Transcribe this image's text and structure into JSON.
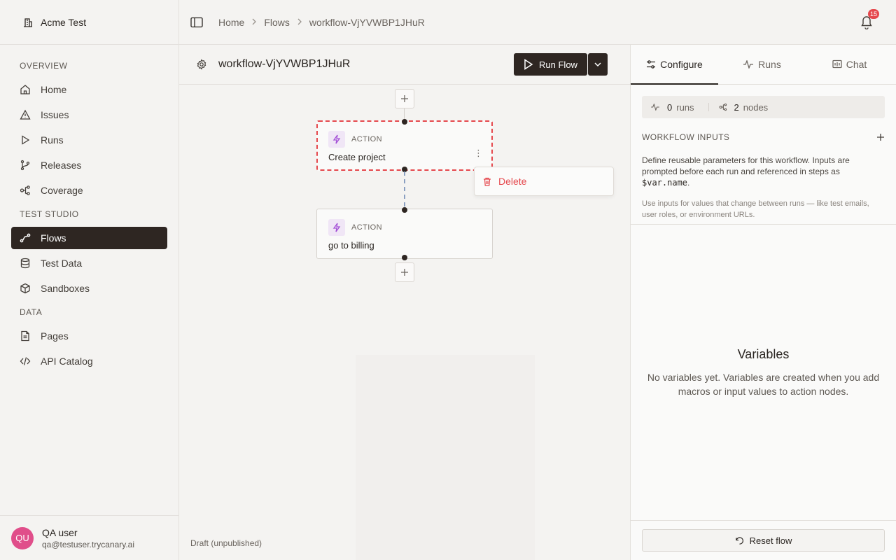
{
  "org": {
    "name": "Acme Test",
    "icon": "building-icon"
  },
  "sidebar": {
    "sections": [
      {
        "label": "OVERVIEW",
        "items": [
          {
            "label": "Home",
            "icon": "home-icon"
          },
          {
            "label": "Issues",
            "icon": "warning-icon"
          },
          {
            "label": "Runs",
            "icon": "play-icon"
          },
          {
            "label": "Releases",
            "icon": "git-branch-icon"
          },
          {
            "label": "Coverage",
            "icon": "coverage-icon"
          }
        ]
      },
      {
        "label": "TEST STUDIO",
        "items": [
          {
            "label": "Flows",
            "icon": "flow-icon",
            "active": true
          },
          {
            "label": "Test Data",
            "icon": "database-icon"
          },
          {
            "label": "Sandboxes",
            "icon": "cube-icon"
          }
        ]
      },
      {
        "label": "DATA",
        "items": [
          {
            "label": "Pages",
            "icon": "document-icon"
          },
          {
            "label": "API Catalog",
            "icon": "code-icon"
          }
        ]
      }
    ]
  },
  "user": {
    "initials": "QU",
    "name": "QA user",
    "email": "qa@testuser.trycanary.ai"
  },
  "breadcrumb": [
    "Home",
    "Flows",
    "workflow-VjYVWBP1JHuR"
  ],
  "notifications": {
    "count": "15"
  },
  "workflow": {
    "title": "workflow-VjYVWBP1JHuR",
    "run_label": "Run Flow",
    "status": "Draft (unpublished)"
  },
  "nodes": [
    {
      "type": "ACTION",
      "label": "Create project",
      "selected": true
    },
    {
      "type": "ACTION",
      "label": "go to billing",
      "selected": false
    }
  ],
  "context_menu": {
    "delete_label": "Delete"
  },
  "panel": {
    "tabs": [
      {
        "label": "Configure",
        "icon": "sliders-icon",
        "active": true
      },
      {
        "label": "Runs",
        "icon": "activity-icon"
      },
      {
        "label": "Chat",
        "icon": "chat-icon"
      }
    ],
    "stats": {
      "runs_count": "0",
      "runs_label": "runs",
      "nodes_count": "2",
      "nodes_label": "nodes"
    },
    "workflow_inputs": {
      "title": "WORKFLOW INPUTS",
      "desc_prefix": "Define reusable parameters for this workflow. Inputs are prompted before each run and referenced in steps as ",
      "desc_code": "$var.name",
      "desc_suffix": ".",
      "hint": "Use inputs for values that change between runs — like test emails, user roles, or environment URLs."
    },
    "variables": {
      "title": "Variables",
      "desc": "No variables yet. Variables are created when you add macros or input values to action nodes."
    },
    "reset_label": "Reset flow"
  },
  "colors": {
    "accent_dark": "#2e2622",
    "danger": "#e5484d",
    "avatar": "#e04e8a",
    "node_icon": "#a34fd6"
  }
}
